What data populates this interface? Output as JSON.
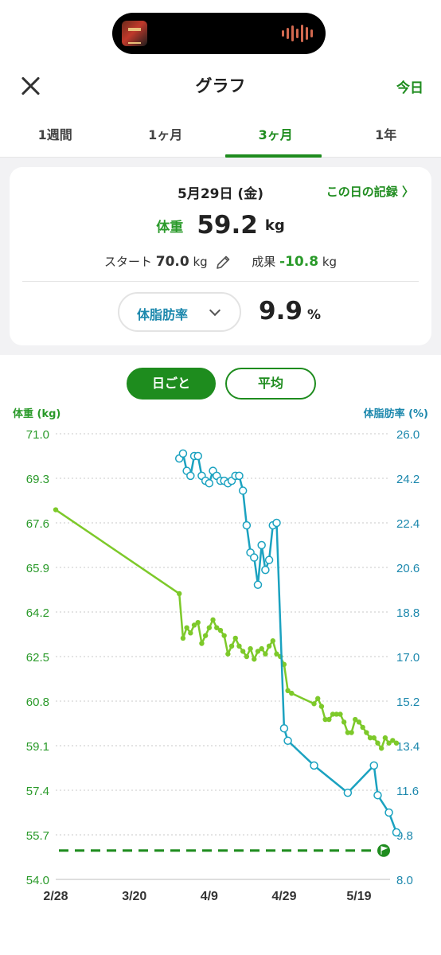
{
  "header": {
    "title": "グラフ",
    "close_icon": "close-icon",
    "today_label": "今日"
  },
  "tabs": [
    {
      "label": "1週間",
      "active": false
    },
    {
      "label": "1ヶ月",
      "active": false
    },
    {
      "label": "3ヶ月",
      "active": true
    },
    {
      "label": "1年",
      "active": false
    }
  ],
  "summary": {
    "date": "5月29日 (金)",
    "day_record_label": "この日の記録 〉",
    "weight_label": "体重",
    "weight_value": "59.2",
    "weight_unit": "kg",
    "start_label": "スタート",
    "start_value": "70.0",
    "start_unit": "kg",
    "result_label": "成果",
    "result_value": "-10.8",
    "result_unit": "kg",
    "metric_select": "体脂肪率",
    "bodyfat_value": "9.9",
    "bodyfat_unit": "%"
  },
  "toggle": {
    "daily_label": "日ごと",
    "average_label": "平均",
    "selected": "daily"
  },
  "colors": {
    "brand_green": "#1e8c1e",
    "weight_line": "#7dc92a",
    "bodyfat_line": "#1ba2c0",
    "goal_line": "#1e8c1e"
  },
  "chart_data": {
    "type": "line",
    "x_axis": {
      "type": "date",
      "tick_labels": [
        "2/28",
        "3/20",
        "4/9",
        "4/29",
        "5/19"
      ],
      "range": [
        "2/28",
        "5/29"
      ]
    },
    "y_left": {
      "label": "体重 (kg)",
      "range": [
        54.0,
        71.0
      ],
      "ticks": [
        "71.0",
        "69.3",
        "67.6",
        "65.9",
        "64.2",
        "62.5",
        "60.8",
        "59.1",
        "57.4",
        "55.7",
        "54.0"
      ]
    },
    "y_right": {
      "label": "体脂肪率 (%)",
      "range": [
        8.0,
        26.0
      ],
      "ticks": [
        "26.0",
        "24.2",
        "22.4",
        "20.6",
        "18.8",
        "17.0",
        "15.2",
        "13.4",
        "11.6",
        "9.8",
        "8.0"
      ]
    },
    "goal": {
      "weight": 55.1,
      "icon": "flag-icon"
    },
    "grid": true,
    "series": [
      {
        "name": "体重",
        "axis": "left",
        "points": [
          [
            "2/28",
            68.1
          ],
          [
            "4/1",
            64.9
          ],
          [
            "4/2",
            63.2
          ],
          [
            "4/3",
            63.6
          ],
          [
            "4/4",
            63.4
          ],
          [
            "4/5",
            63.7
          ],
          [
            "4/6",
            63.8
          ],
          [
            "4/7",
            63.0
          ],
          [
            "4/8",
            63.3
          ],
          [
            "4/9",
            63.6
          ],
          [
            "4/10",
            63.9
          ],
          [
            "4/11",
            63.6
          ],
          [
            "4/12",
            63.5
          ],
          [
            "4/13",
            63.3
          ],
          [
            "4/14",
            62.6
          ],
          [
            "4/15",
            62.9
          ],
          [
            "4/16",
            63.2
          ],
          [
            "4/17",
            62.9
          ],
          [
            "4/18",
            62.7
          ],
          [
            "4/19",
            62.5
          ],
          [
            "4/20",
            62.8
          ],
          [
            "4/21",
            62.4
          ],
          [
            "4/22",
            62.7
          ],
          [
            "4/23",
            62.8
          ],
          [
            "4/24",
            62.6
          ],
          [
            "4/25",
            62.9
          ],
          [
            "4/26",
            63.1
          ],
          [
            "4/27",
            62.6
          ],
          [
            "4/28",
            62.5
          ],
          [
            "4/29",
            62.2
          ],
          [
            "4/30",
            61.2
          ],
          [
            "5/1",
            61.1
          ],
          [
            "5/7",
            60.7
          ],
          [
            "5/8",
            60.9
          ],
          [
            "5/9",
            60.6
          ],
          [
            "5/10",
            60.1
          ],
          [
            "5/11",
            60.1
          ],
          [
            "5/12",
            60.3
          ],
          [
            "5/13",
            60.3
          ],
          [
            "5/14",
            60.3
          ],
          [
            "5/15",
            60.0
          ],
          [
            "5/16",
            59.6
          ],
          [
            "5/17",
            59.6
          ],
          [
            "5/18",
            60.1
          ],
          [
            "5/19",
            60.0
          ],
          [
            "5/20",
            59.8
          ],
          [
            "5/21",
            59.6
          ],
          [
            "5/22",
            59.4
          ],
          [
            "5/23",
            59.4
          ],
          [
            "5/24",
            59.2
          ],
          [
            "5/25",
            59.0
          ],
          [
            "5/26",
            59.4
          ],
          [
            "5/27",
            59.2
          ],
          [
            "5/28",
            59.3
          ],
          [
            "5/29",
            59.2
          ]
        ]
      },
      {
        "name": "体脂肪率",
        "axis": "right",
        "points": [
          [
            "4/1",
            25.0
          ],
          [
            "4/2",
            25.2
          ],
          [
            "4/3",
            24.5
          ],
          [
            "4/4",
            24.3
          ],
          [
            "4/5",
            25.1
          ],
          [
            "4/6",
            25.1
          ],
          [
            "4/7",
            24.3
          ],
          [
            "4/8",
            24.1
          ],
          [
            "4/9",
            24.0
          ],
          [
            "4/10",
            24.5
          ],
          [
            "4/11",
            24.3
          ],
          [
            "4/12",
            24.1
          ],
          [
            "4/13",
            24.1
          ],
          [
            "4/14",
            24.0
          ],
          [
            "4/15",
            24.1
          ],
          [
            "4/16",
            24.3
          ],
          [
            "4/17",
            24.3
          ],
          [
            "4/18",
            23.7
          ],
          [
            "4/19",
            22.3
          ],
          [
            "4/20",
            21.2
          ],
          [
            "4/21",
            21.0
          ],
          [
            "4/22",
            19.9
          ],
          [
            "4/23",
            21.5
          ],
          [
            "4/24",
            20.5
          ],
          [
            "4/25",
            20.9
          ],
          [
            "4/26",
            22.3
          ],
          [
            "4/27",
            22.4
          ],
          [
            "4/29",
            14.1
          ],
          [
            "4/30",
            13.6
          ],
          [
            "5/7",
            12.6
          ],
          [
            "5/16",
            11.5
          ],
          [
            "5/23",
            12.6
          ],
          [
            "5/24",
            11.4
          ],
          [
            "5/27",
            10.7
          ],
          [
            "5/29",
            9.9
          ]
        ]
      }
    ]
  }
}
